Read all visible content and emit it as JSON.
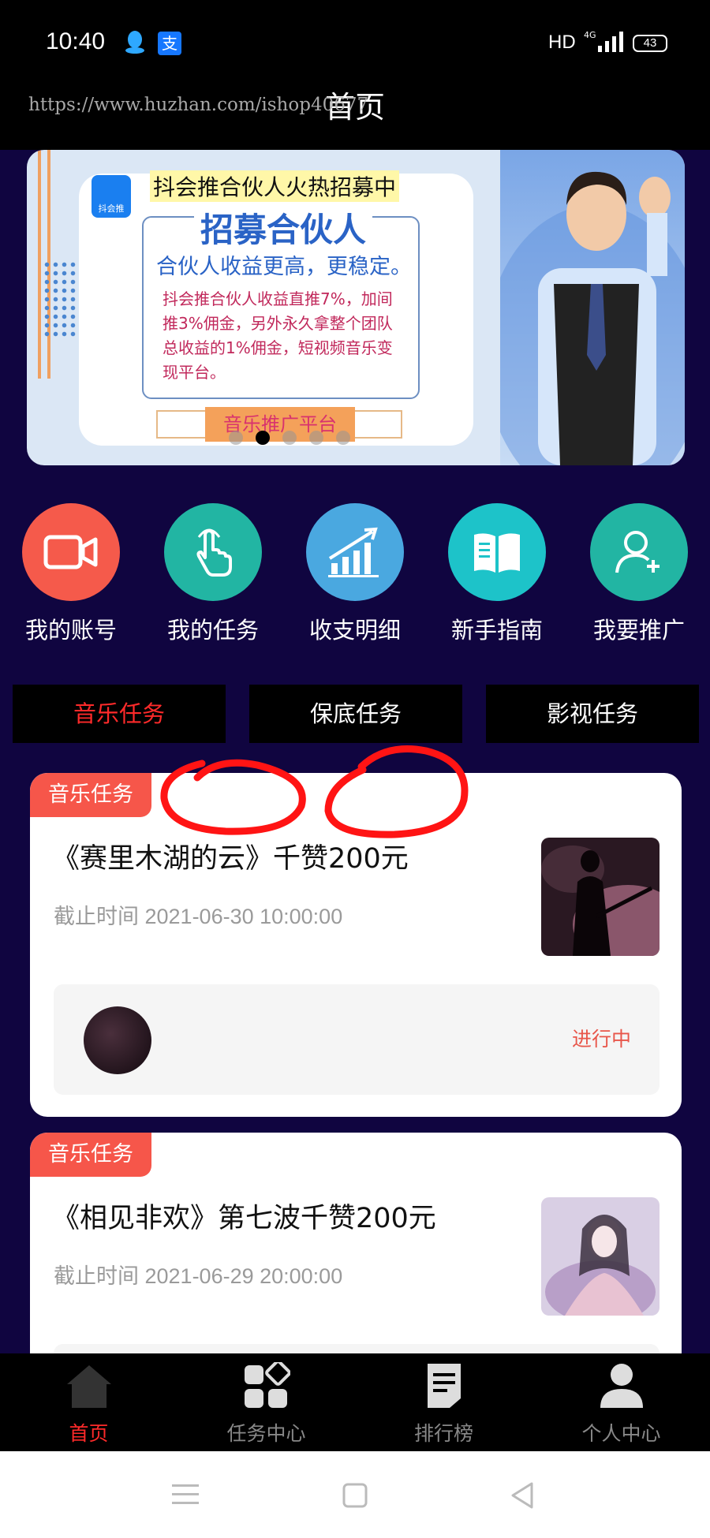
{
  "status_bar": {
    "time": "10:40",
    "network_hd": "HD",
    "network_4g": "4G",
    "battery": "43"
  },
  "header": {
    "title": "首页",
    "url_watermark": "https://www.huzhan.com/ishop40677"
  },
  "banner": {
    "headline": "抖会推合伙人火热招募中",
    "logo_text": "抖会推",
    "title": "招募合伙人",
    "subtitle": "合伙人收益更高，更稳定。",
    "body": "抖会推合伙人收益直推7%，加间推3%佣金，另外永久拿整个团队总收益的1%佣金，短视频音乐变现平台。",
    "button": "音乐推广平台",
    "slides": 5,
    "active_slide": 1
  },
  "quick_menu": [
    {
      "label": "我的账号",
      "icon": "video-camera-icon",
      "color": "#f55a4b"
    },
    {
      "label": "我的任务",
      "icon": "tap-hand-icon",
      "color": "#22b5a3"
    },
    {
      "label": "收支明细",
      "icon": "growth-chart-icon",
      "color": "#4aa8e0"
    },
    {
      "label": "新手指南",
      "icon": "open-book-icon",
      "color": "#1dc3c9"
    },
    {
      "label": "我要推广",
      "icon": "add-user-icon",
      "color": "#22b5a3"
    }
  ],
  "tabs": [
    {
      "label": "音乐任务",
      "active": true
    },
    {
      "label": "保底任务",
      "active": false
    },
    {
      "label": "影视任务",
      "active": false
    }
  ],
  "tasks": [
    {
      "badge": "音乐任务",
      "title": "《赛里木湖的云》千赞200元",
      "deadline": "截止时间 2021-06-30 10:00:00",
      "status": "进行中"
    },
    {
      "badge": "音乐任务",
      "title": "《相见非欢》第七波千赞200元",
      "deadline": "截止时间 2021-06-29 20:00:00",
      "status": ""
    }
  ],
  "bottom_nav": [
    {
      "label": "首页",
      "icon": "home-icon",
      "active": true
    },
    {
      "label": "任务中心",
      "icon": "grid-diamond-icon",
      "active": false
    },
    {
      "label": "排行榜",
      "icon": "document-icon",
      "active": false
    },
    {
      "label": "个人中心",
      "icon": "person-icon",
      "active": false
    }
  ],
  "colors": {
    "accent_red": "#ff2a2a",
    "main_bg": "#100540",
    "badge": "#f6564a"
  }
}
